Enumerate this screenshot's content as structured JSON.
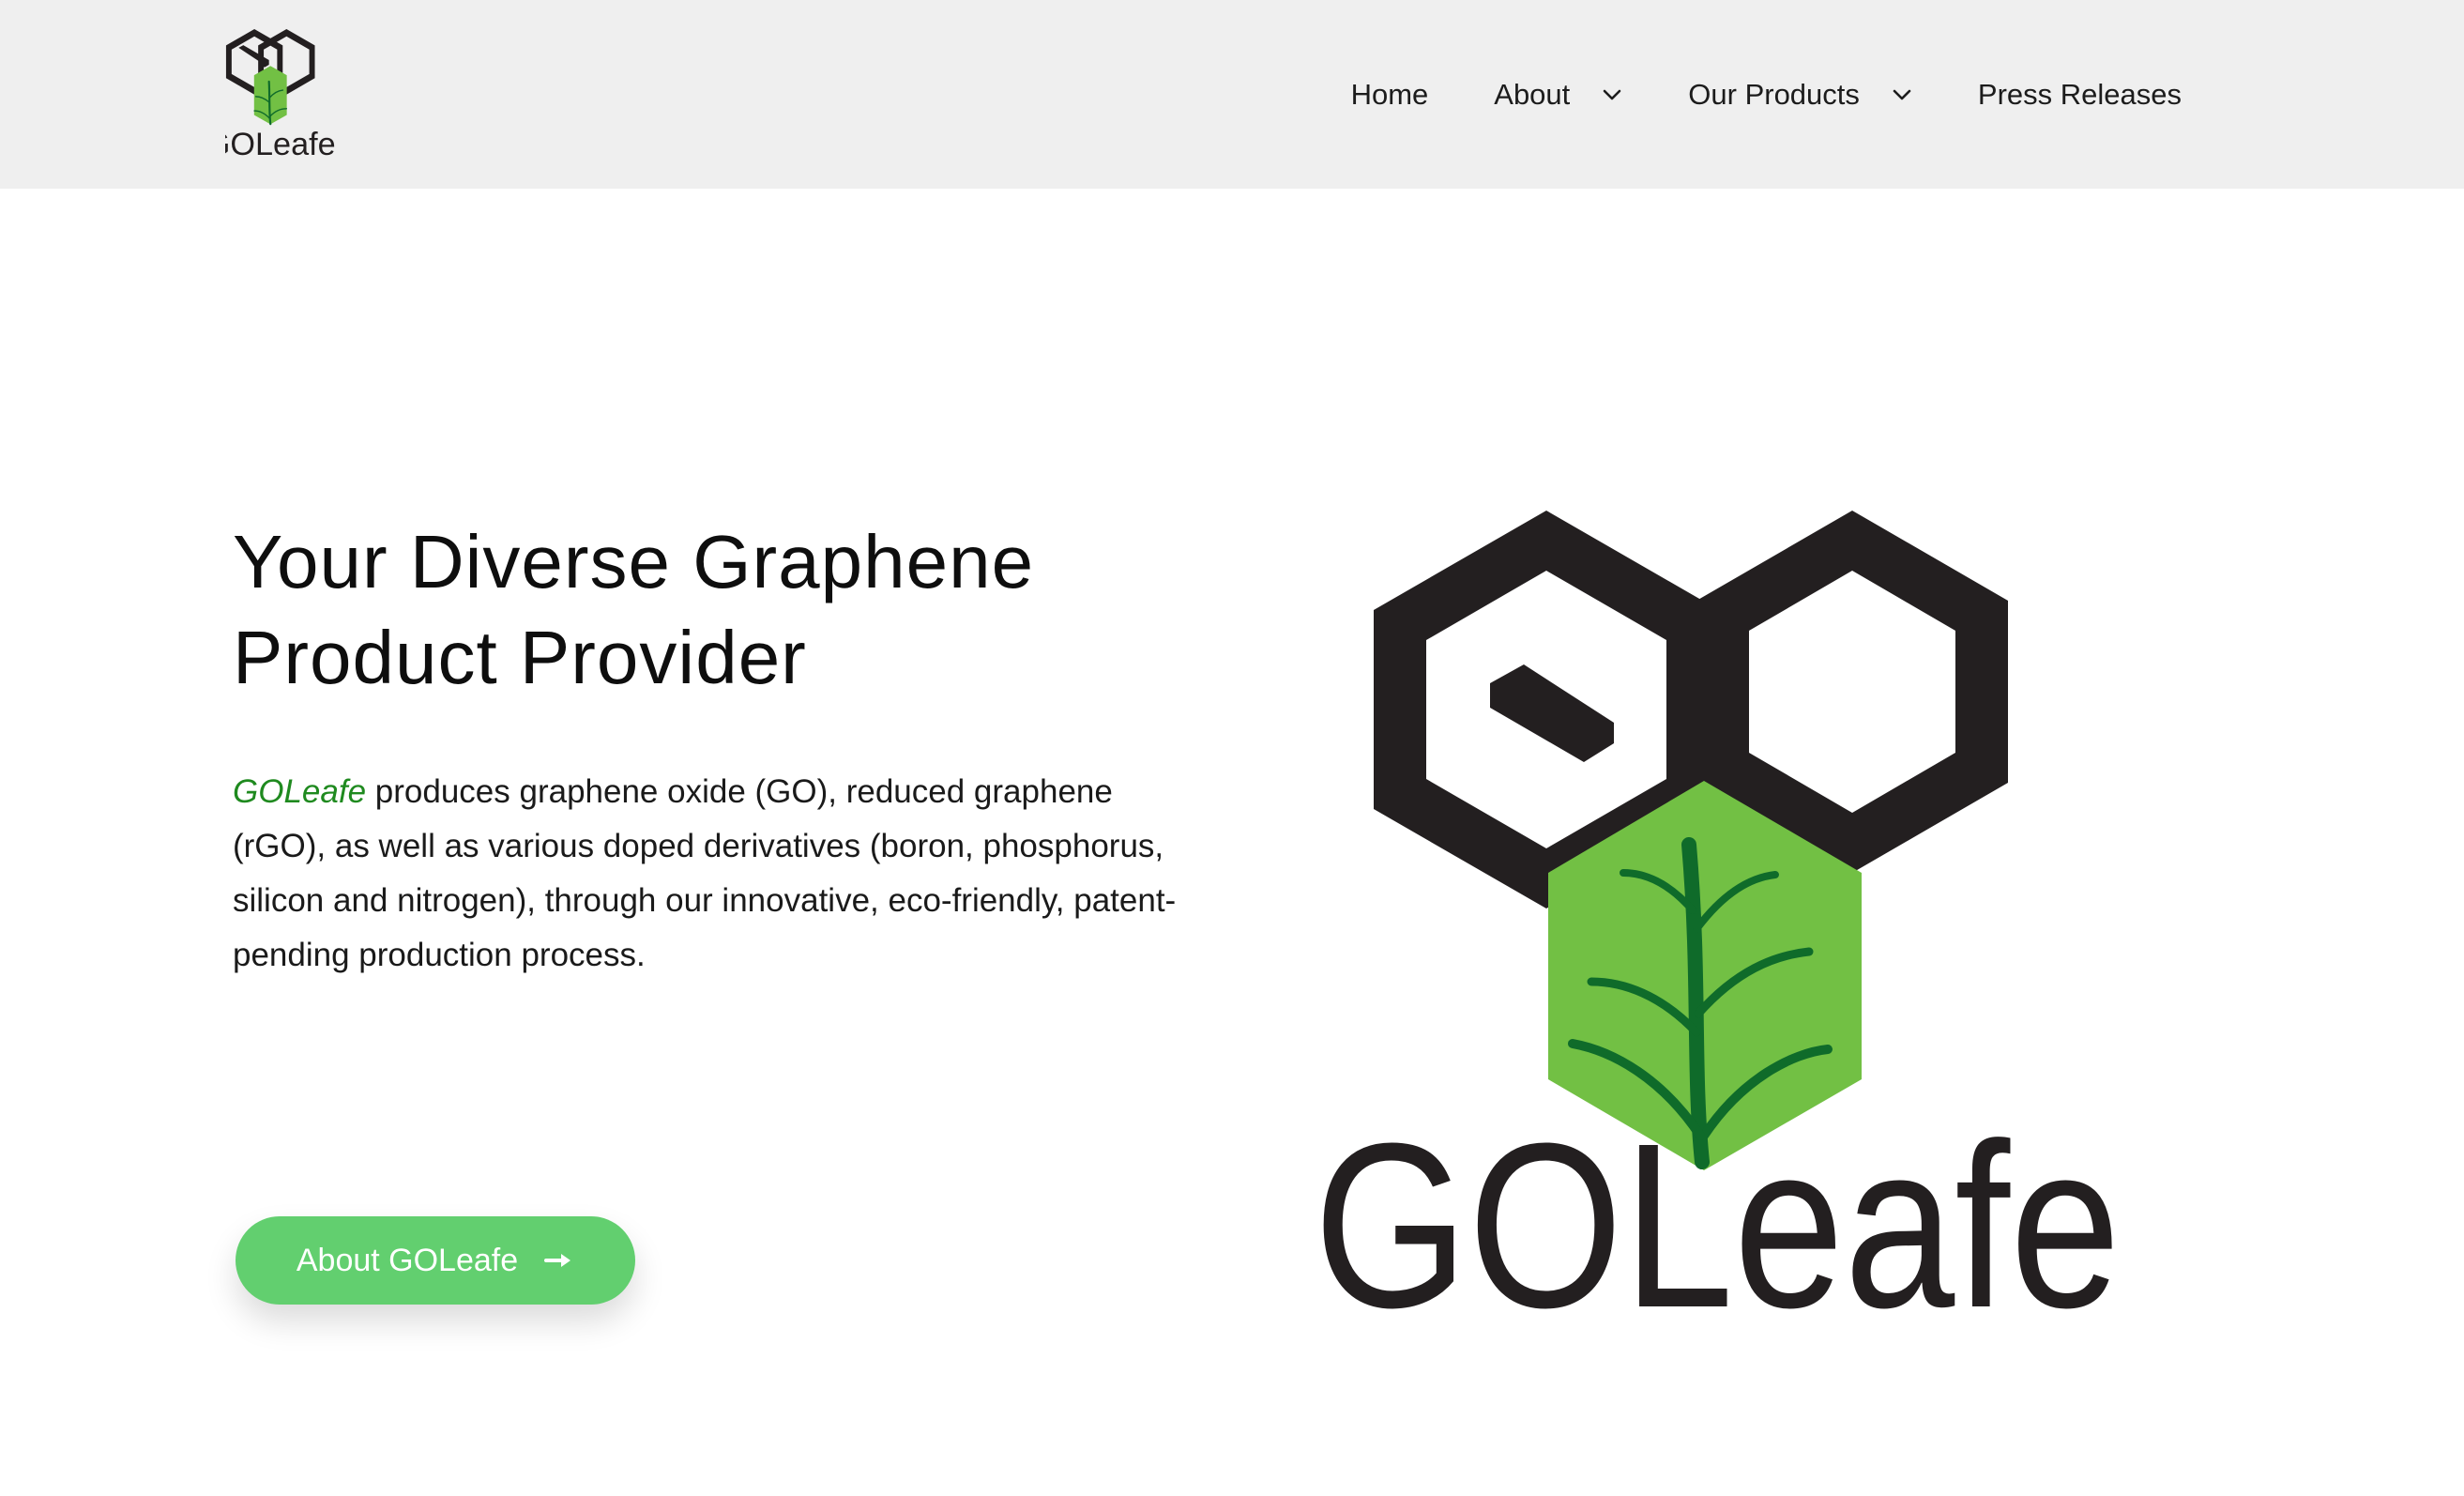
{
  "header": {
    "logo_text": "GOLeafe",
    "nav": [
      {
        "label": "Home",
        "has_dropdown": false
      },
      {
        "label": "About",
        "has_dropdown": true
      },
      {
        "label": "Our Products",
        "has_dropdown": true
      },
      {
        "label": "Press Releases",
        "has_dropdown": false
      }
    ]
  },
  "hero": {
    "title_line1": "Your Diverse Graphene",
    "title_line2": "Product Provider",
    "brand": "GOLeafe",
    "description": " produces graphene oxide (GO), reduced graphene (rGO), as well as various doped derivatives (boron, phosphorus, silicon and nitrogen), through our innovative, eco-friendly, patent-pending production process.",
    "cta_label": "About GOLeafe",
    "cta_icon": "arrow-right-icon",
    "logo_text": "GOLeafe"
  },
  "colors": {
    "header_bg": "#efefef",
    "brand_green": "#1f8a1f",
    "cta_green": "#62cf6f",
    "leaf_hex": "#72c044",
    "plant": "#0f6b2a",
    "logo_dark": "#231f20"
  }
}
